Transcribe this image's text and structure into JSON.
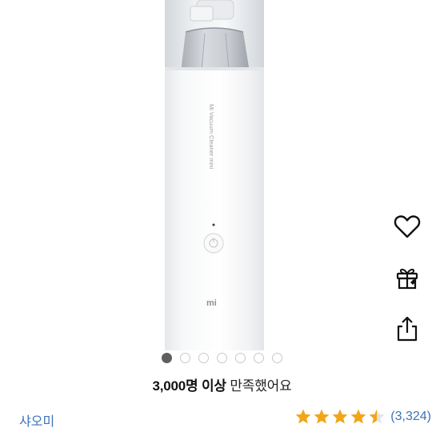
{
  "product": {
    "model_text": "Mi Vacuum Cleaner mini",
    "logo_text": "mi"
  },
  "actions": {
    "wishlist_icon": "heart-outline-icon",
    "gift_icon": "gift-box-icon",
    "share_icon": "share-upload-icon"
  },
  "gallery": {
    "total_images": 7,
    "current_index": 1
  },
  "satisfaction": {
    "count_text": "3,000명 이상",
    "suffix_text": "만족했어요"
  },
  "brand": {
    "name": "샤오미"
  },
  "rating": {
    "value": 4.5,
    "max": 5,
    "count_text": "(3,324)",
    "star_color": "#f2a516"
  },
  "colors": {
    "link": "#3d73b8",
    "dot_active": "#5f5f5f"
  }
}
